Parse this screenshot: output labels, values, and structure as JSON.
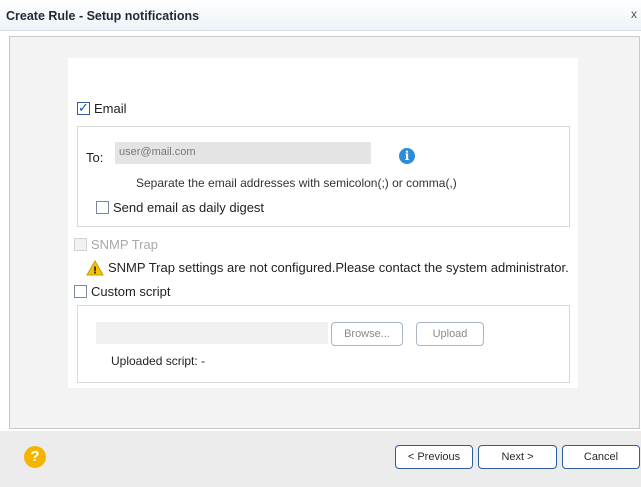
{
  "window": {
    "title": "Create Rule - Setup notifications",
    "close_glyph": "x"
  },
  "email": {
    "label": "Email",
    "checked": true,
    "to_label": "To:",
    "to_value": "user@mail.com",
    "hint": "Separate the email addresses with semicolon(;) or comma(,)",
    "digest_label": "Send email as daily digest",
    "digest_checked": false,
    "info_icon": "info-icon",
    "info_glyph": "i"
  },
  "snmp": {
    "label": "SNMP Trap",
    "disabled": true,
    "warning": "SNMP Trap settings are not configured.Please contact the system administrator.",
    "warning_icon": "warning-icon",
    "warning_glyph": "!"
  },
  "custom_script": {
    "label": "Custom script",
    "checked": false,
    "browse_label": "Browse...",
    "upload_label": "Upload",
    "uploaded_text": "Uploaded script: -"
  },
  "footer": {
    "previous_label": "< Previous",
    "next_label": "Next >",
    "cancel_label": "Cancel",
    "help_icon": "help-icon",
    "help_glyph": "?"
  },
  "colors": {
    "accent": "#2c5e9e",
    "info": "#2e8cd6",
    "warning": "#f5c400",
    "help": "#f5b400"
  }
}
